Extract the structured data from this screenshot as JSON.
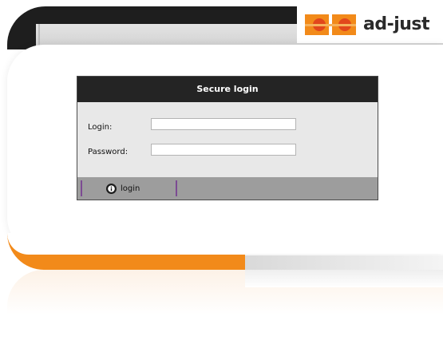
{
  "brand": {
    "name": "ad-just"
  },
  "login_panel": {
    "title": "Secure login",
    "login_label": "Login:",
    "password_label": "Password:",
    "login_value": "",
    "password_value": "",
    "submit_label": "login"
  },
  "colors": {
    "accent_orange": "#f28a1a",
    "header_dark": "#242424",
    "panel_bg": "#e8e8e8",
    "footer_bar": "#9d9d9d",
    "separator_purple": "#7c4b93"
  },
  "icons": {
    "login_icon": "info-circle-icon",
    "logo_icon": "ad-just-logo-icon"
  }
}
